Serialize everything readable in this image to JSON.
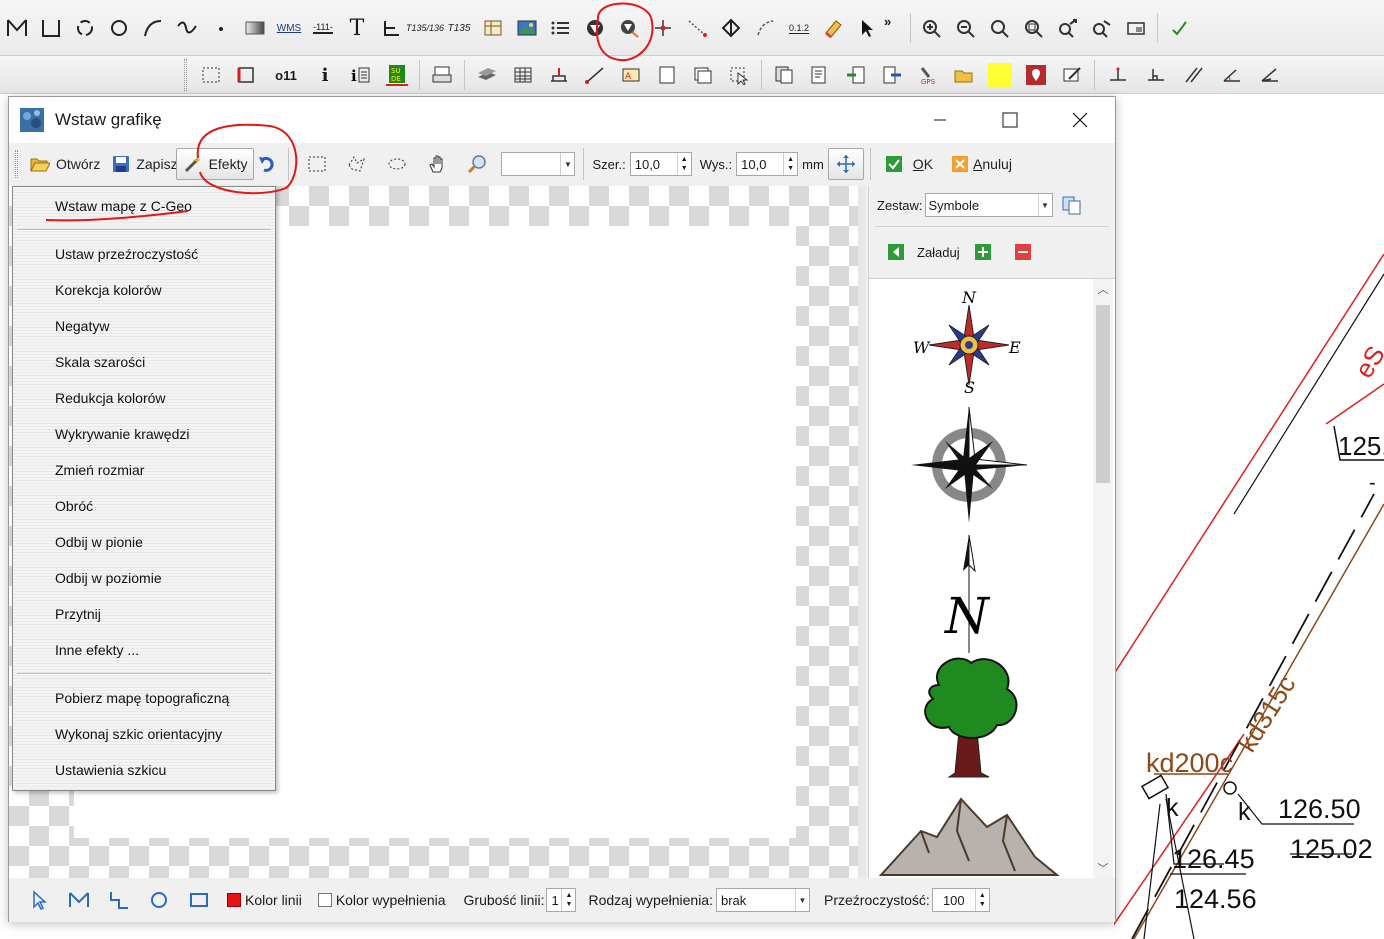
{
  "app": {
    "top_toolbar_text_labels": {
      "wms": "WMS",
      "dim": "-111-",
      "t135": "T135/136",
      "tsub": "T135",
      "coord": "0.1.2"
    },
    "second_toolbar_text_labels": {
      "label_11": "o11",
      "info": "i"
    }
  },
  "dialog": {
    "title": "Wstaw grafikę",
    "toolbar": {
      "open": "Otwórz",
      "save": "Zapisz",
      "effects": "Efekty",
      "size_combo_value": "",
      "width_label": "Szer.:",
      "width_value": "10,0",
      "height_label": "Wys.:",
      "height_value": "10,0",
      "unit": "mm",
      "ok": "OK",
      "cancel": "Anuluj"
    },
    "symbol_panel": {
      "set_label": "Zestaw:",
      "set_value": "Symbole",
      "load": "Załaduj",
      "symbols": [
        "compass-rose",
        "compass-star",
        "north-arrow",
        "tree",
        "mountains"
      ],
      "compass_letters": {
        "n": "N",
        "s": "S",
        "e": "E",
        "w": "W"
      }
    },
    "bottom": {
      "line_color": "Kolor linii",
      "fill_color": "Kolor wypełnienia",
      "line_width_label": "Grubość linii:",
      "line_width_value": "1",
      "fill_type_label": "Rodzaj wypełnienia:",
      "fill_type_value": "brak",
      "transparency_label": "Przeźroczystość:",
      "transparency_value": "100"
    }
  },
  "effects_menu": {
    "items": [
      "Wstaw mapę z C-Geo",
      "Ustaw przeźroczystość",
      "Korekcja kolorów",
      "Negatyw",
      "Skala szarości",
      "Redukcja kolorów",
      "Wykrywanie krawędzi",
      "Zmień rozmiar",
      "Obróć",
      "Odbij w pionie",
      "Odbij w poziomie",
      "Przytnij",
      "Inne efekty ...",
      "Pobierz mapę topograficzną",
      "Wykonaj szkic orientacyjny",
      "Ustawienia szkicu"
    ]
  },
  "map": {
    "labels": {
      "es_fragment": "eS",
      "value_125": "125.",
      "dash": "-",
      "kd315c": "kd315c",
      "kd200c": "kd200c",
      "k1": "k",
      "k2": "k",
      "h1_top": "126.50",
      "h1_bottom": "125.02",
      "h2_top": "126.45",
      "h2_bottom": "124.56"
    },
    "colors": {
      "red_line": "#e0201c",
      "brown_line": "#8a4a1a",
      "black_line": "#111111"
    }
  },
  "colors": {
    "annotation_red": "#e01818",
    "line_color_swatch": "#e31414",
    "highlight_yellow": "#ffff33"
  }
}
